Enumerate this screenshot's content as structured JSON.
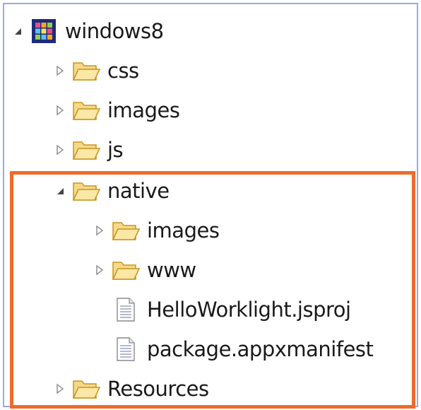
{
  "tree": {
    "root": {
      "label": "windows8",
      "icon": "project-grid-icon",
      "expanded": true
    },
    "children": [
      {
        "label": "css",
        "icon": "folder-icon",
        "expanded": false
      },
      {
        "label": "images",
        "icon": "folder-icon",
        "expanded": false
      },
      {
        "label": "js",
        "icon": "folder-icon",
        "expanded": false
      },
      {
        "label": "native",
        "icon": "folder-icon",
        "expanded": true,
        "children": [
          {
            "label": "images",
            "icon": "folder-icon",
            "expanded": false
          },
          {
            "label": "www",
            "icon": "folder-icon",
            "expanded": false
          },
          {
            "label": "HelloWorklight.jsproj",
            "icon": "file-icon"
          },
          {
            "label": "package.appxmanifest",
            "icon": "file-icon"
          }
        ]
      },
      {
        "label": "Resources",
        "icon": "folder-icon",
        "expanded": false
      }
    ]
  },
  "colors": {
    "frame_border": "#9aa7f0",
    "highlight_border": "#f06a2a",
    "folder_fill": "#f5d98a",
    "folder_stroke": "#c8951e"
  }
}
